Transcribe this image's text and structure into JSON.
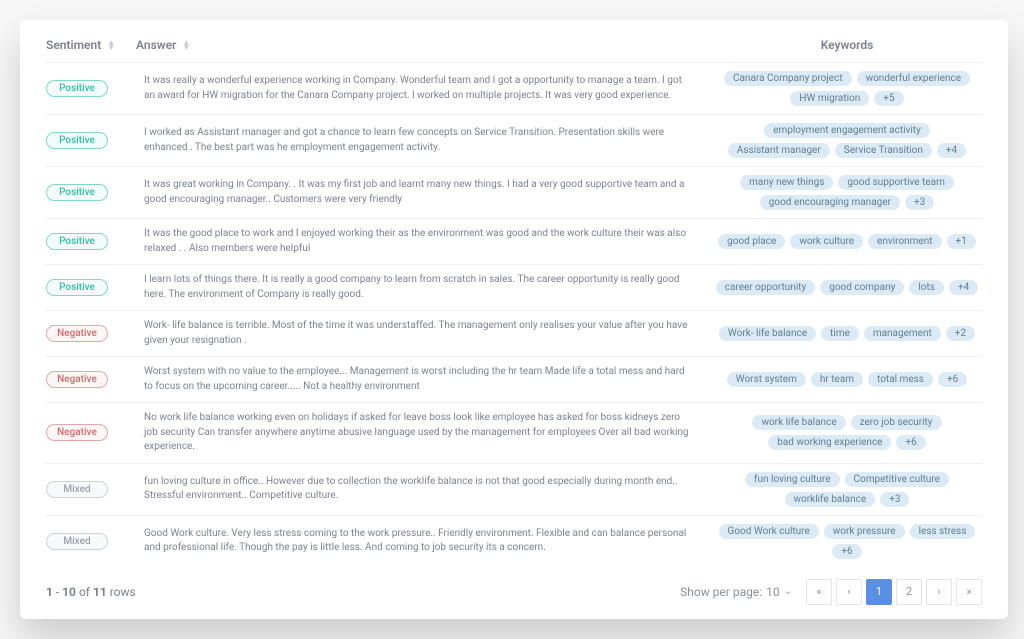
{
  "columns": {
    "sentiment": "Sentiment",
    "answer": "Answer",
    "keywords": "Keywords"
  },
  "rows": [
    {
      "sentiment": "Positive",
      "sentiment_class": "positive",
      "answer": "It was really a wonderful experience working in Company. Wonderful team and I got a opportunity to manage a team. I got an award for HW migration for the Canara Company project. I worked on multiple projects. It was very good experience.",
      "keywords": [
        "Canara Company project",
        "wonderful experience",
        "HW migration"
      ],
      "extra": "+5"
    },
    {
      "sentiment": "Positive",
      "sentiment_class": "positive",
      "answer": "I worked as Assistant manager and got a chance to learn few concepts on Service Transition. Presentation skills were enhanced . The best part was he employment engagement activity.",
      "keywords": [
        "employment engagement activity",
        "Assistant manager",
        "Service Transition"
      ],
      "extra": "+4"
    },
    {
      "sentiment": "Positive",
      "sentiment_class": "positive",
      "answer": "It was great working in Company. . It was my first job and learnt many new things. I had a very good supportive team and a good encouraging manager.. Customers were very friendly",
      "keywords": [
        "many new things",
        "good supportive team",
        "good encouraging manager"
      ],
      "extra": "+3"
    },
    {
      "sentiment": "Positive",
      "sentiment_class": "positive",
      "answer": "It was the good place to work and I enjoyed working their as the environment was good and the work culture their was also relaxed . . Also members were helpful",
      "keywords": [
        "good place",
        "work culture",
        "environment"
      ],
      "extra": "+1"
    },
    {
      "sentiment": "Positive",
      "sentiment_class": "positive",
      "answer": "I learn lots of things there. It is really a good company to learn from scratch in sales. The career opportunity is really good here. The environment of Company is really good.",
      "keywords": [
        "career opportunity",
        "good company",
        "lots"
      ],
      "extra": "+4"
    },
    {
      "sentiment": "Negative",
      "sentiment_class": "negative",
      "answer": "Work- life balance is terrible. Most of the time it was understaffed. The management only realises your value after you have given your resignation .",
      "keywords": [
        "Work- life balance",
        "time",
        "management"
      ],
      "extra": "+2"
    },
    {
      "sentiment": "Negative",
      "sentiment_class": "negative",
      "answer": "Worst system with no value to the employee... Management is worst including the hr team Made life a total mess and hard to focus on the upcoming career..... Not a healthy environment",
      "keywords": [
        "Worst system",
        "hr team",
        "total mess"
      ],
      "extra": "+6"
    },
    {
      "sentiment": "Negative",
      "sentiment_class": "negative",
      "answer": "No work life balance working even on holidays if asked for leave boss look like employee has asked for boss kidneys zero job security Can transfer anywhere anytime abusive language used by the management for employees Over all bad working experience.",
      "keywords": [
        "work life balance",
        "zero job security",
        "bad working experience"
      ],
      "extra": "+6"
    },
    {
      "sentiment": "Mixed",
      "sentiment_class": "mixed",
      "answer": "fun loving culture in office.. However due to collection the worklife balance is not that good especially during month end.. Stressful environment.. Competitive culture.",
      "keywords": [
        "fun loving culture",
        "Competitive culture",
        "worklife balance"
      ],
      "extra": "+3"
    },
    {
      "sentiment": "Mixed",
      "sentiment_class": "mixed",
      "answer": "Good Work culture. Very less stress coming to the work pressure.. Friendly environment. Flexible and can balance personal and professional life. Though the pay is little less. And coming to job security its a concern.",
      "keywords": [
        "Good Work culture",
        "work pressure",
        "less stress"
      ],
      "extra": "+6"
    }
  ],
  "footer": {
    "range_from": "1",
    "range_to": "10",
    "of_label": "of",
    "total": "11",
    "rows_label": "rows",
    "perpage_label": "Show per page:",
    "perpage_value": "10",
    "pager": {
      "first": "«",
      "prev": "‹",
      "page1": "1",
      "page2": "2",
      "next": "›",
      "last": "»"
    }
  }
}
